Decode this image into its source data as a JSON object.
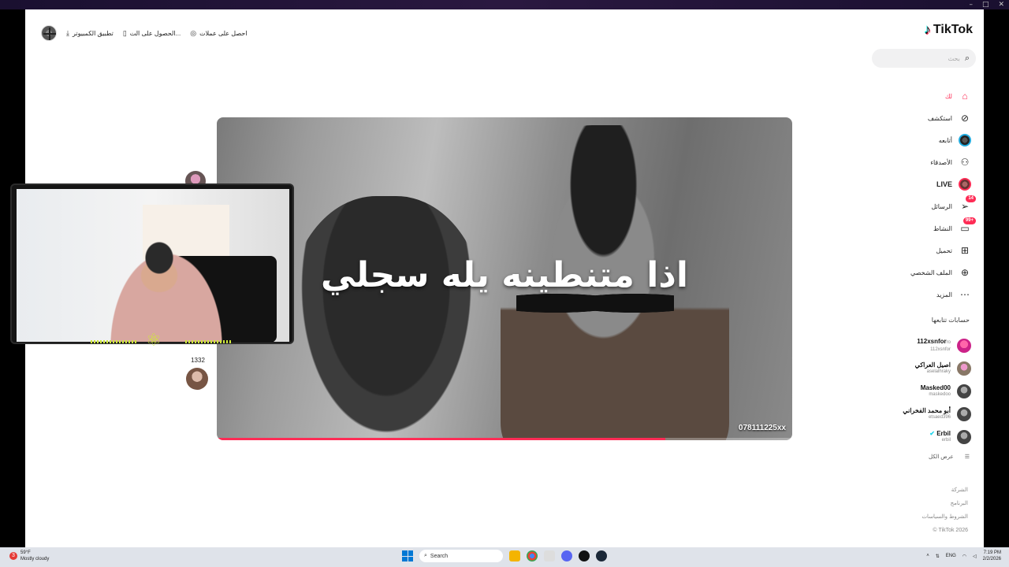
{
  "window": {
    "controls": [
      "–",
      "□",
      "✕"
    ]
  },
  "topbar": {
    "coins_label": "احصل على عملات",
    "app_label": "الحصول على الت...",
    "desktop_label": "تطبيق الكمبيوتر"
  },
  "sidebar": {
    "logo": "TikTok",
    "search_placeholder": "بحث",
    "nav": [
      {
        "label": "لك",
        "icon": "home-icon"
      },
      {
        "label": "استكشف",
        "icon": "compass-icon"
      },
      {
        "label": "أتابعه",
        "icon": "following-avatar-icon"
      },
      {
        "label": "الأصدقاء",
        "icon": "friends-icon"
      },
      {
        "label": "LIVE",
        "icon": "live-icon"
      },
      {
        "label": "الرسائل",
        "icon": "messages-icon",
        "badge": "14"
      },
      {
        "label": "النشاط",
        "icon": "activity-icon",
        "badge": "99+"
      },
      {
        "label": "تحميل",
        "icon": "upload-icon"
      },
      {
        "label": "الملف الشخصي",
        "icon": "profile-icon"
      },
      {
        "label": "المزيد",
        "icon": "more-icon"
      }
    ],
    "following_header": "حسابات تتابعها",
    "following": [
      {
        "name": "112xsnfor",
        "suffix": "ro",
        "handle": "112xsnfor"
      },
      {
        "name": "اصيل العراكي",
        "handle": "aselalhraky"
      },
      {
        "name": "Masked00",
        "handle": "maskedoo"
      },
      {
        "name": "أبو محمد الفخراني",
        "handle": "etsaed396"
      },
      {
        "name": "Erbil",
        "handle": "erbil",
        "verified": true
      }
    ],
    "show_all": "عرض الكل",
    "footer": [
      "الشركة",
      "البرنامج",
      "الشروط والسياسات",
      "TikTok 2026 ©"
    ]
  },
  "video": {
    "caption": "اذا متنطينه يله سجلي",
    "watermark": "078111225xx",
    "progress": 0.78
  },
  "actions": {
    "count": "1332"
  },
  "taskbar": {
    "weather_temp": "59°F",
    "weather_desc": "Mostly cloudy",
    "weather_badge": "3",
    "search_label": "Search",
    "lang": "ENG",
    "time": "7:19 PM",
    "date": "2/2/2026"
  }
}
